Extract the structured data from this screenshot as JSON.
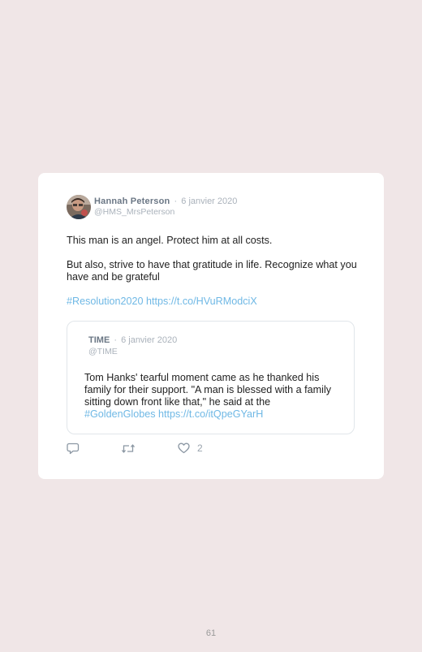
{
  "tweet": {
    "author_name": "Hannah Peterson",
    "date": "6 janvier 2020",
    "handle": "@HMS_MrsPeterson",
    "line1": "This man is an angel. Protect him at all costs.",
    "line2": "But also, strive to have that gratitude in life. Recognize what you have and be grateful",
    "hashtag": "#Resolution2020",
    "link": "https://t.co/HVuRModciX",
    "like_count": "2"
  },
  "quoted": {
    "author_name": "TIME",
    "date": "6 janvier 2020",
    "handle": "@TIME",
    "text": "Tom Hanks' tearful moment came as he thanked his family for their support. \"A man is blessed with a family sitting down front like that,\" he said at the",
    "hashtag": "#GoldenGlobes",
    "link": "https://t.co/itQpeGYarH"
  },
  "page": {
    "number": "61"
  },
  "colors": {
    "page_background": "#f0e6e7",
    "card_background": "#ffffff",
    "link": "#6fb8e5",
    "muted": "#aab2bb"
  },
  "icons": {
    "reply": "reply-icon",
    "retweet": "retweet-icon",
    "like": "heart-icon"
  }
}
